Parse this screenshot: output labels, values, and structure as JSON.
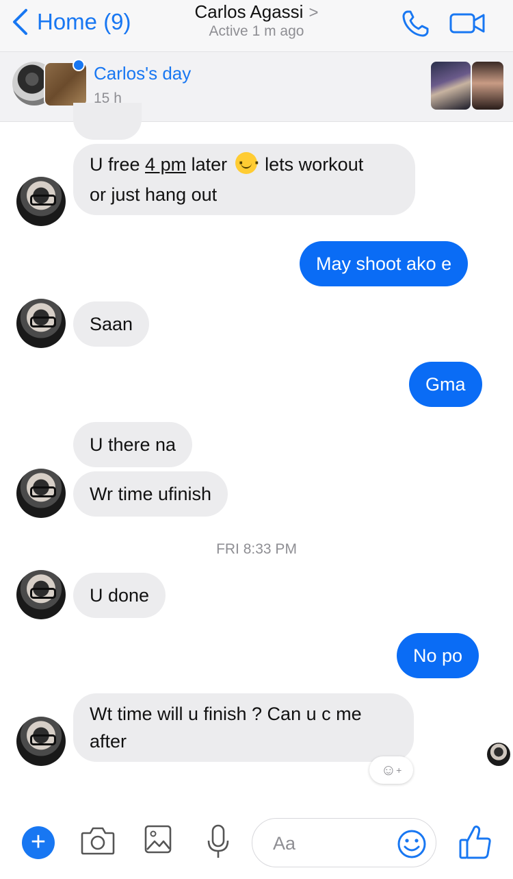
{
  "header": {
    "back_label": "Home (9)",
    "contact_name": "Carlos Agassi",
    "chevron": ">",
    "status": "Active 1 m ago"
  },
  "story": {
    "title": "Carlos's day",
    "time": "15 h"
  },
  "messages": {
    "m1_a": "U free",
    "m1_b": "4 pm",
    "m1_c": "later",
    "m1_d": "lets workout",
    "m1_line2": "or just hang out",
    "m2": "May shoot ako e",
    "m3": "Saan",
    "m4": "Gma",
    "m5": "U there na",
    "m6": "Wr time ufinish",
    "timestamp": "FRI 8:33 PM",
    "m7": "U done",
    "m8": "No po",
    "m9_line1": "Wt time will u finish ? Can u c me",
    "m9_line2": "after"
  },
  "composer": {
    "placeholder": "Aa"
  },
  "colors": {
    "accent": "#1877f2",
    "outgoing_bubble": "#0a6cf5",
    "incoming_bubble": "#ececee"
  }
}
